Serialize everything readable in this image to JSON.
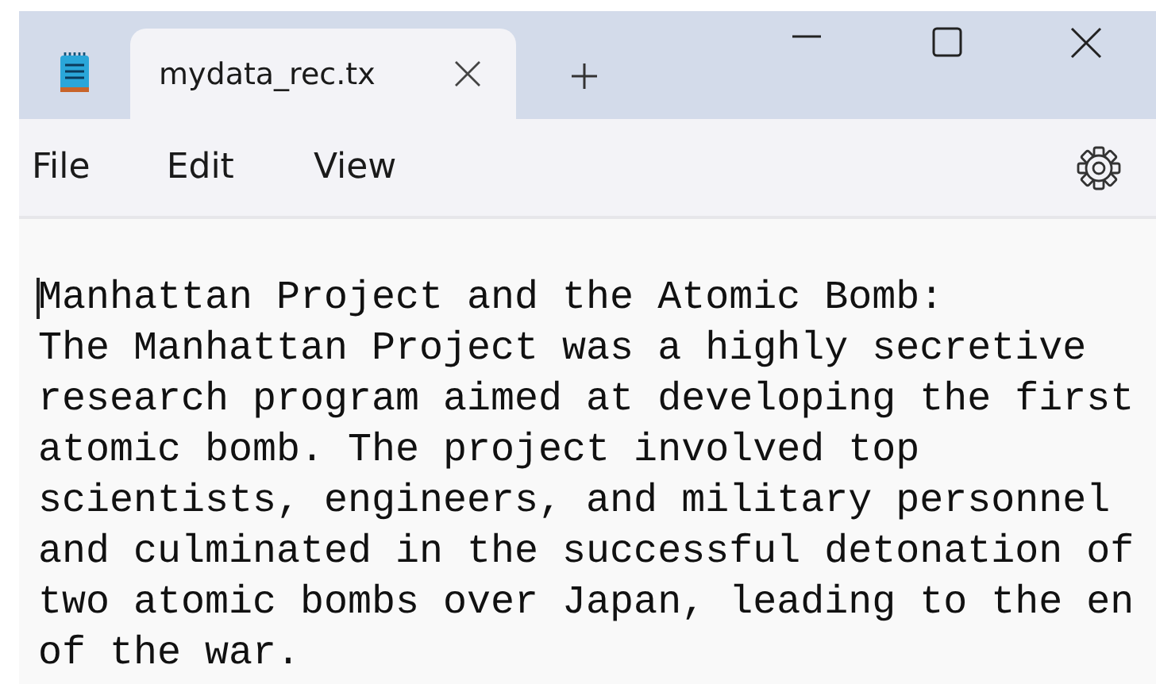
{
  "tabs": [
    {
      "title": "mydata_rec.tx",
      "selected": true
    }
  ],
  "menu": [
    "File",
    "Edit",
    "View"
  ],
  "document": {
    "lines": [
      "Manhattan Project and the Atomic Bomb:",
      "The Manhattan Project was a highly secretive",
      "research program aimed at developing the first",
      "atomic bomb. The project involved top",
      "scientists, engineers, and military personnel",
      "and culminated in the successful detonation of",
      "two atomic bombs over Japan, leading to the en",
      "of the war."
    ]
  }
}
